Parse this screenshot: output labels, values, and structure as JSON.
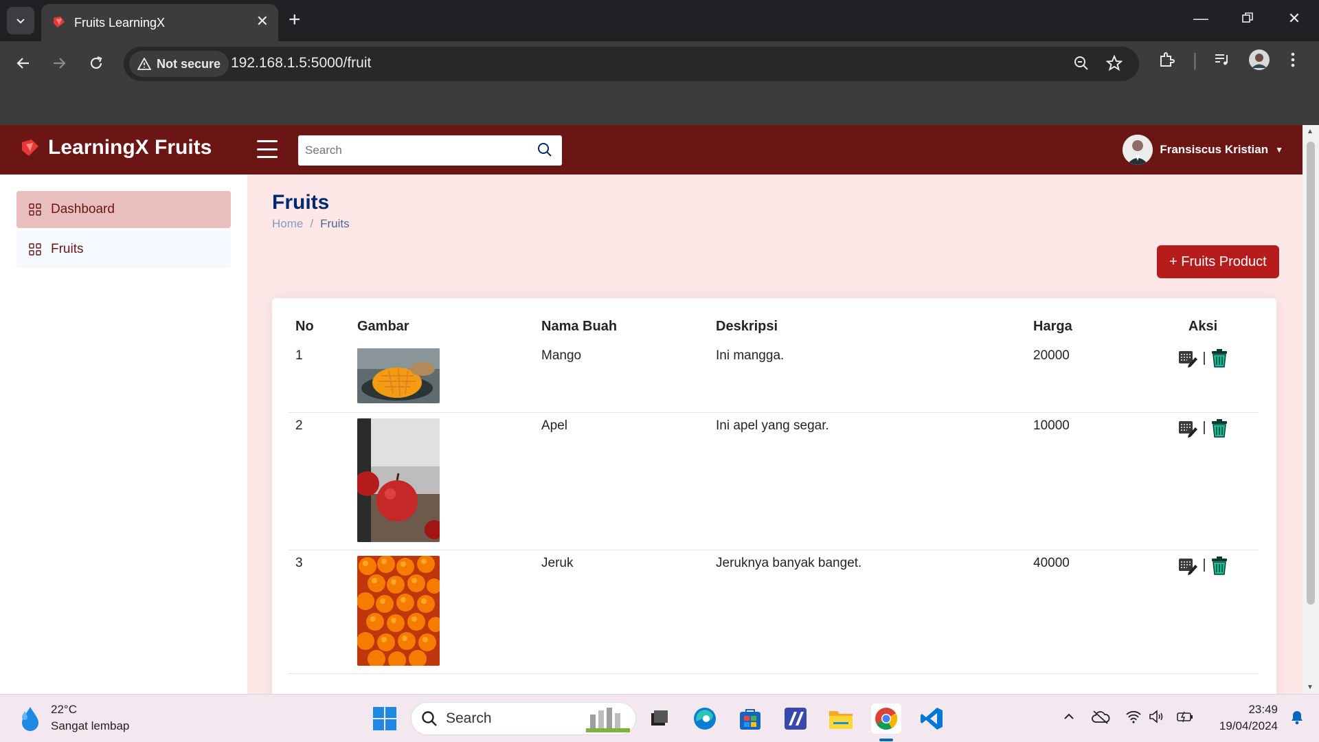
{
  "browser": {
    "tab_title": "Fruits LearningX",
    "security_label": "Not secure",
    "url": "192.168.1.5:5000/fruit"
  },
  "app": {
    "brand": "LearningX Fruits",
    "search_placeholder": "Search",
    "user_name": "Fransiscus Kristian",
    "accent_color": "#6b1515"
  },
  "sidebar": {
    "items": [
      {
        "label": "Dashboard",
        "active": true
      },
      {
        "label": "Fruits",
        "active": false
      }
    ]
  },
  "main": {
    "title": "Fruits",
    "breadcrumb": [
      "Home",
      "/",
      "Fruits"
    ],
    "add_button": "+ Fruits Product",
    "table": {
      "headers": [
        "No",
        "Gambar",
        "Nama Buah",
        "Deskripsi",
        "Harga",
        "Aksi"
      ],
      "rows": [
        {
          "no": "1",
          "image": "mango-photo",
          "name": "Mango",
          "description": "Ini mangga.",
          "price": "20000"
        },
        {
          "no": "2",
          "image": "apple-photo",
          "name": "Apel",
          "description": "Ini apel yang segar.",
          "price": "10000"
        },
        {
          "no": "3",
          "image": "orange-photo",
          "name": "Jeruk",
          "description": "Jeruknya banyak banget.",
          "price": "40000"
        }
      ],
      "action_separator": "|"
    }
  },
  "taskbar": {
    "temperature": "22°C",
    "weather": "Sangat lembap",
    "search_label": "Search",
    "time": "23:49",
    "date": "19/04/2024"
  }
}
